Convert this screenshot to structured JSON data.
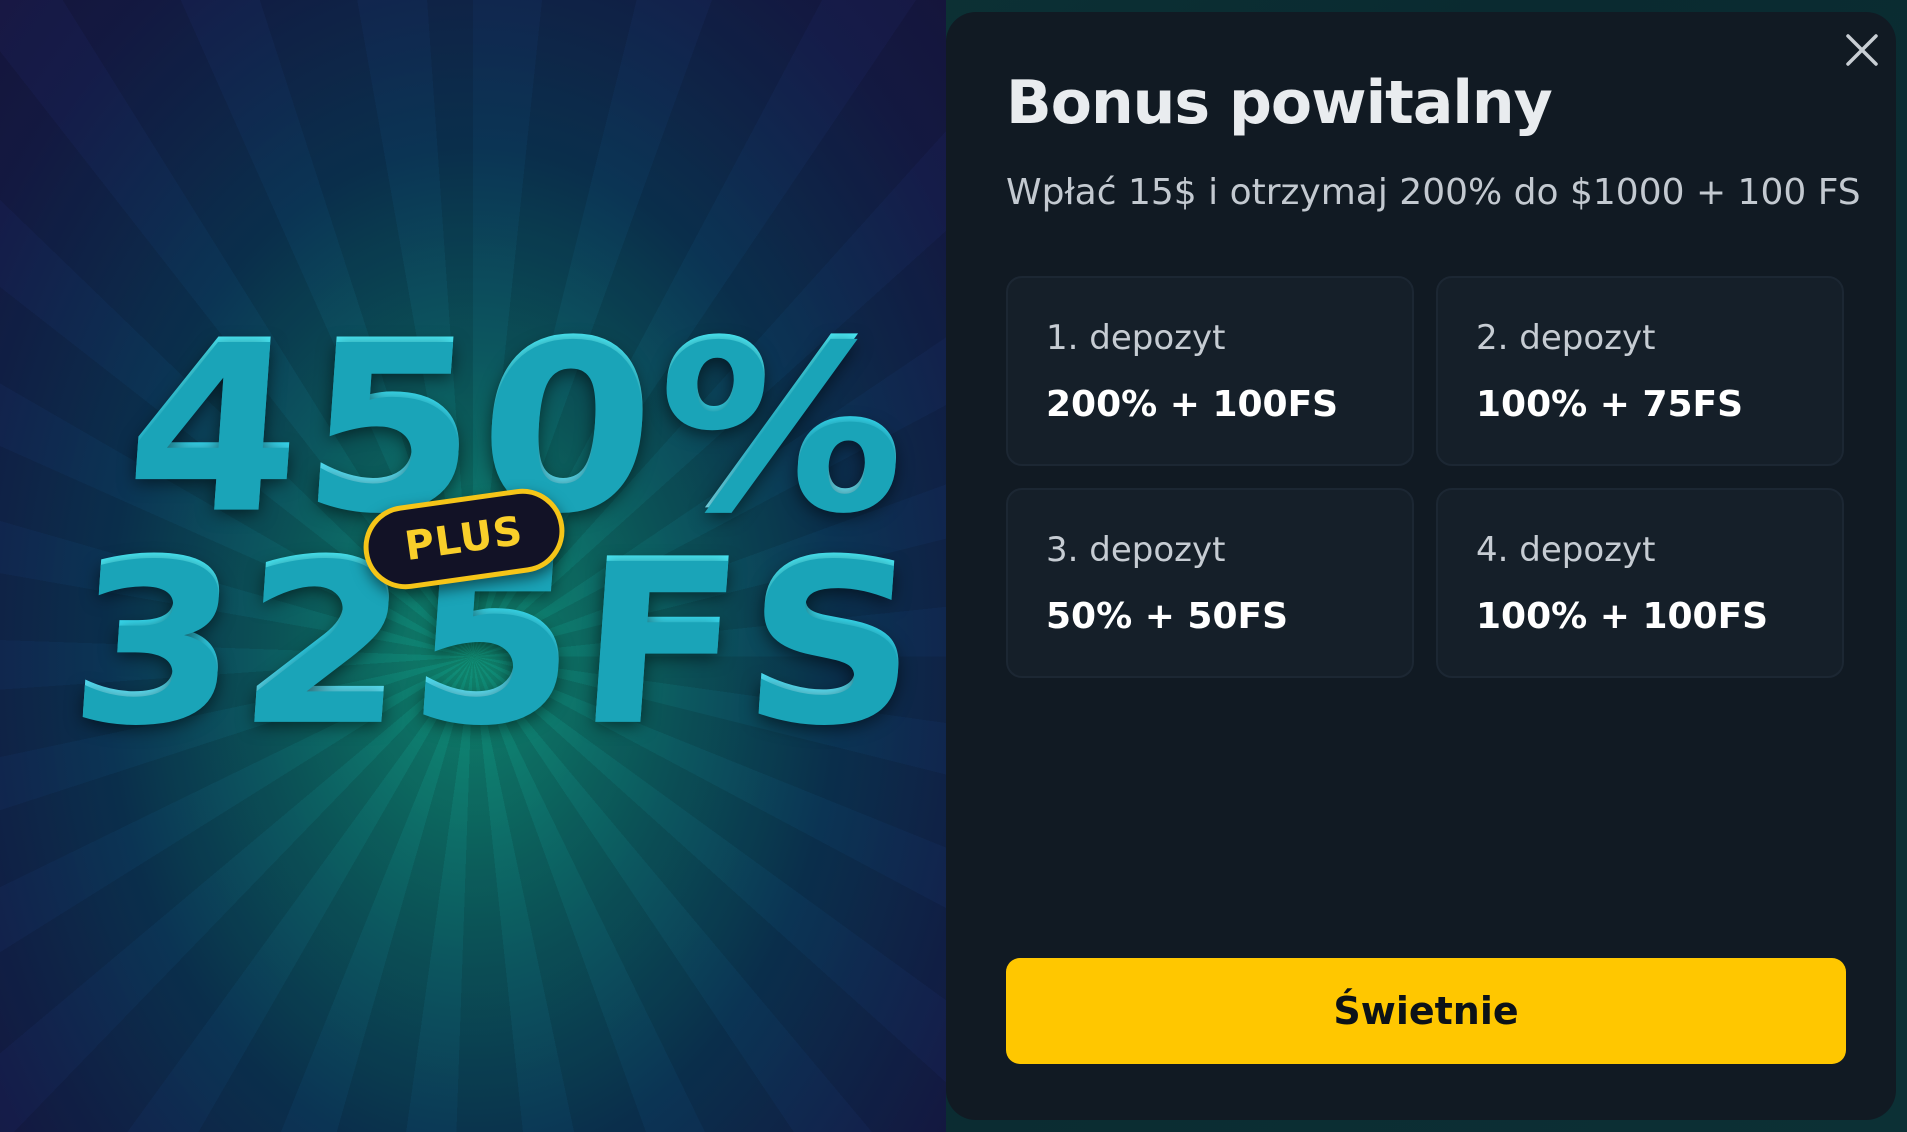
{
  "promo": {
    "headline_line1": "450%",
    "badge": "PLUS",
    "headline_line2": "325FS"
  },
  "modal": {
    "title": "Bonus powitalny",
    "subtitle": "Wpłać 15$ i otrzymaj 200% do $1000 + 100 FS",
    "close_icon": "close-icon",
    "deposits": [
      {
        "label": "1. depozyt",
        "value": "200% + 100FS"
      },
      {
        "label": "2. depozyt",
        "value": "100% + 75FS"
      },
      {
        "label": "3. depozyt",
        "value": "50% + 50FS"
      },
      {
        "label": "4. depozyt",
        "value": "100% + 100FS"
      }
    ],
    "cta_label": "Świetnie"
  },
  "colors": {
    "accent": "#ffc700",
    "panel_bg": "#111a23",
    "card_bg": "#151f29",
    "promo_text": "#3ee6f5"
  }
}
